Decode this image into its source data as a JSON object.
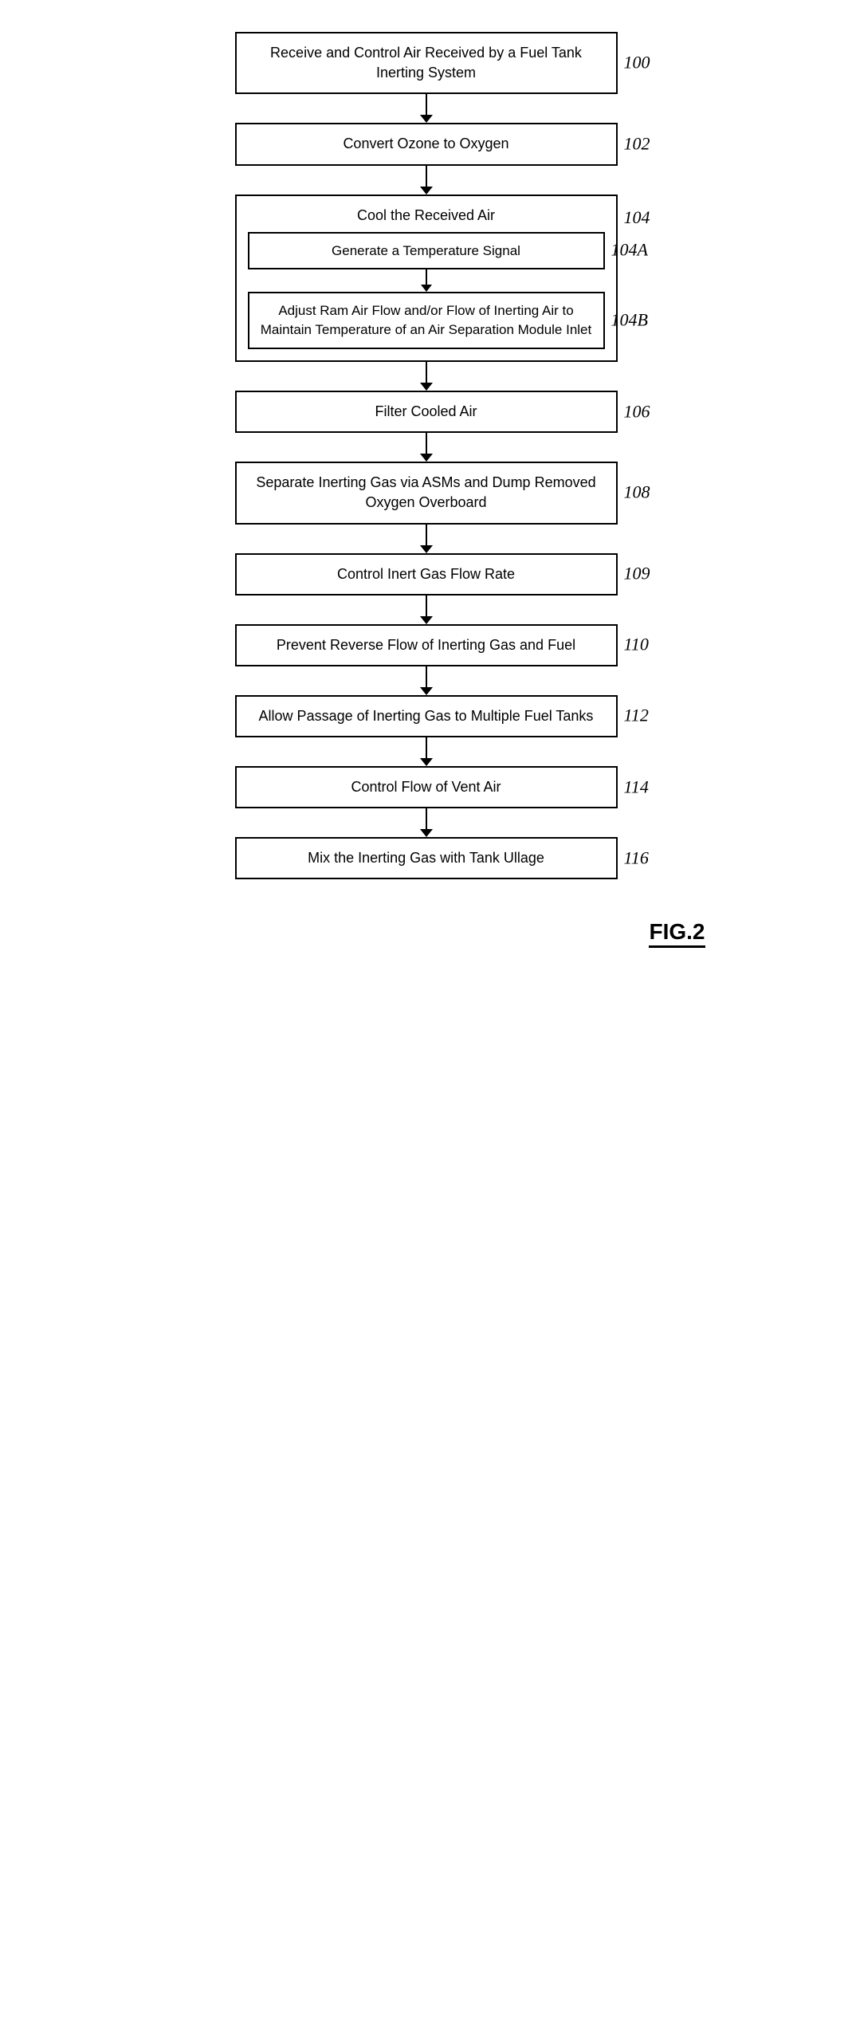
{
  "diagram": {
    "title": "FIG.2",
    "steps": [
      {
        "id": "step-100",
        "label": "100",
        "text": "Receive and Control Air Received by a Fuel Tank Inerting System",
        "type": "main"
      },
      {
        "id": "step-102",
        "label": "102",
        "text": "Convert Ozone to Oxygen",
        "type": "main"
      },
      {
        "id": "step-104",
        "label": "104",
        "text": "Cool the Received Air",
        "type": "nested-parent",
        "nested": [
          {
            "id": "step-104a",
            "label": "104A",
            "text": "Generate a Temperature Signal"
          },
          {
            "id": "step-104b",
            "label": "104B",
            "text": "Adjust Ram Air Flow and/or Flow of Inerting Air to Maintain Temperature of an Air Separation Module Inlet"
          }
        ]
      },
      {
        "id": "step-106",
        "label": "106",
        "text": "Filter Cooled Air",
        "type": "main"
      },
      {
        "id": "step-108",
        "label": "108",
        "text": "Separate Inerting Gas via ASMs and Dump Removed Oxygen Overboard",
        "type": "main"
      },
      {
        "id": "step-109",
        "label": "109",
        "text": "Control Inert Gas Flow Rate",
        "type": "main"
      },
      {
        "id": "step-110",
        "label": "110",
        "text": "Prevent Reverse Flow of Inerting Gas and Fuel",
        "type": "main"
      },
      {
        "id": "step-112",
        "label": "112",
        "text": "Allow Passage of Inerting Gas to Multiple Fuel Tanks",
        "type": "main"
      },
      {
        "id": "step-114",
        "label": "114",
        "text": "Control Flow of Vent Air",
        "type": "main"
      },
      {
        "id": "step-116",
        "label": "116",
        "text": "Mix the Inerting Gas with Tank Ullage",
        "type": "main"
      }
    ]
  }
}
